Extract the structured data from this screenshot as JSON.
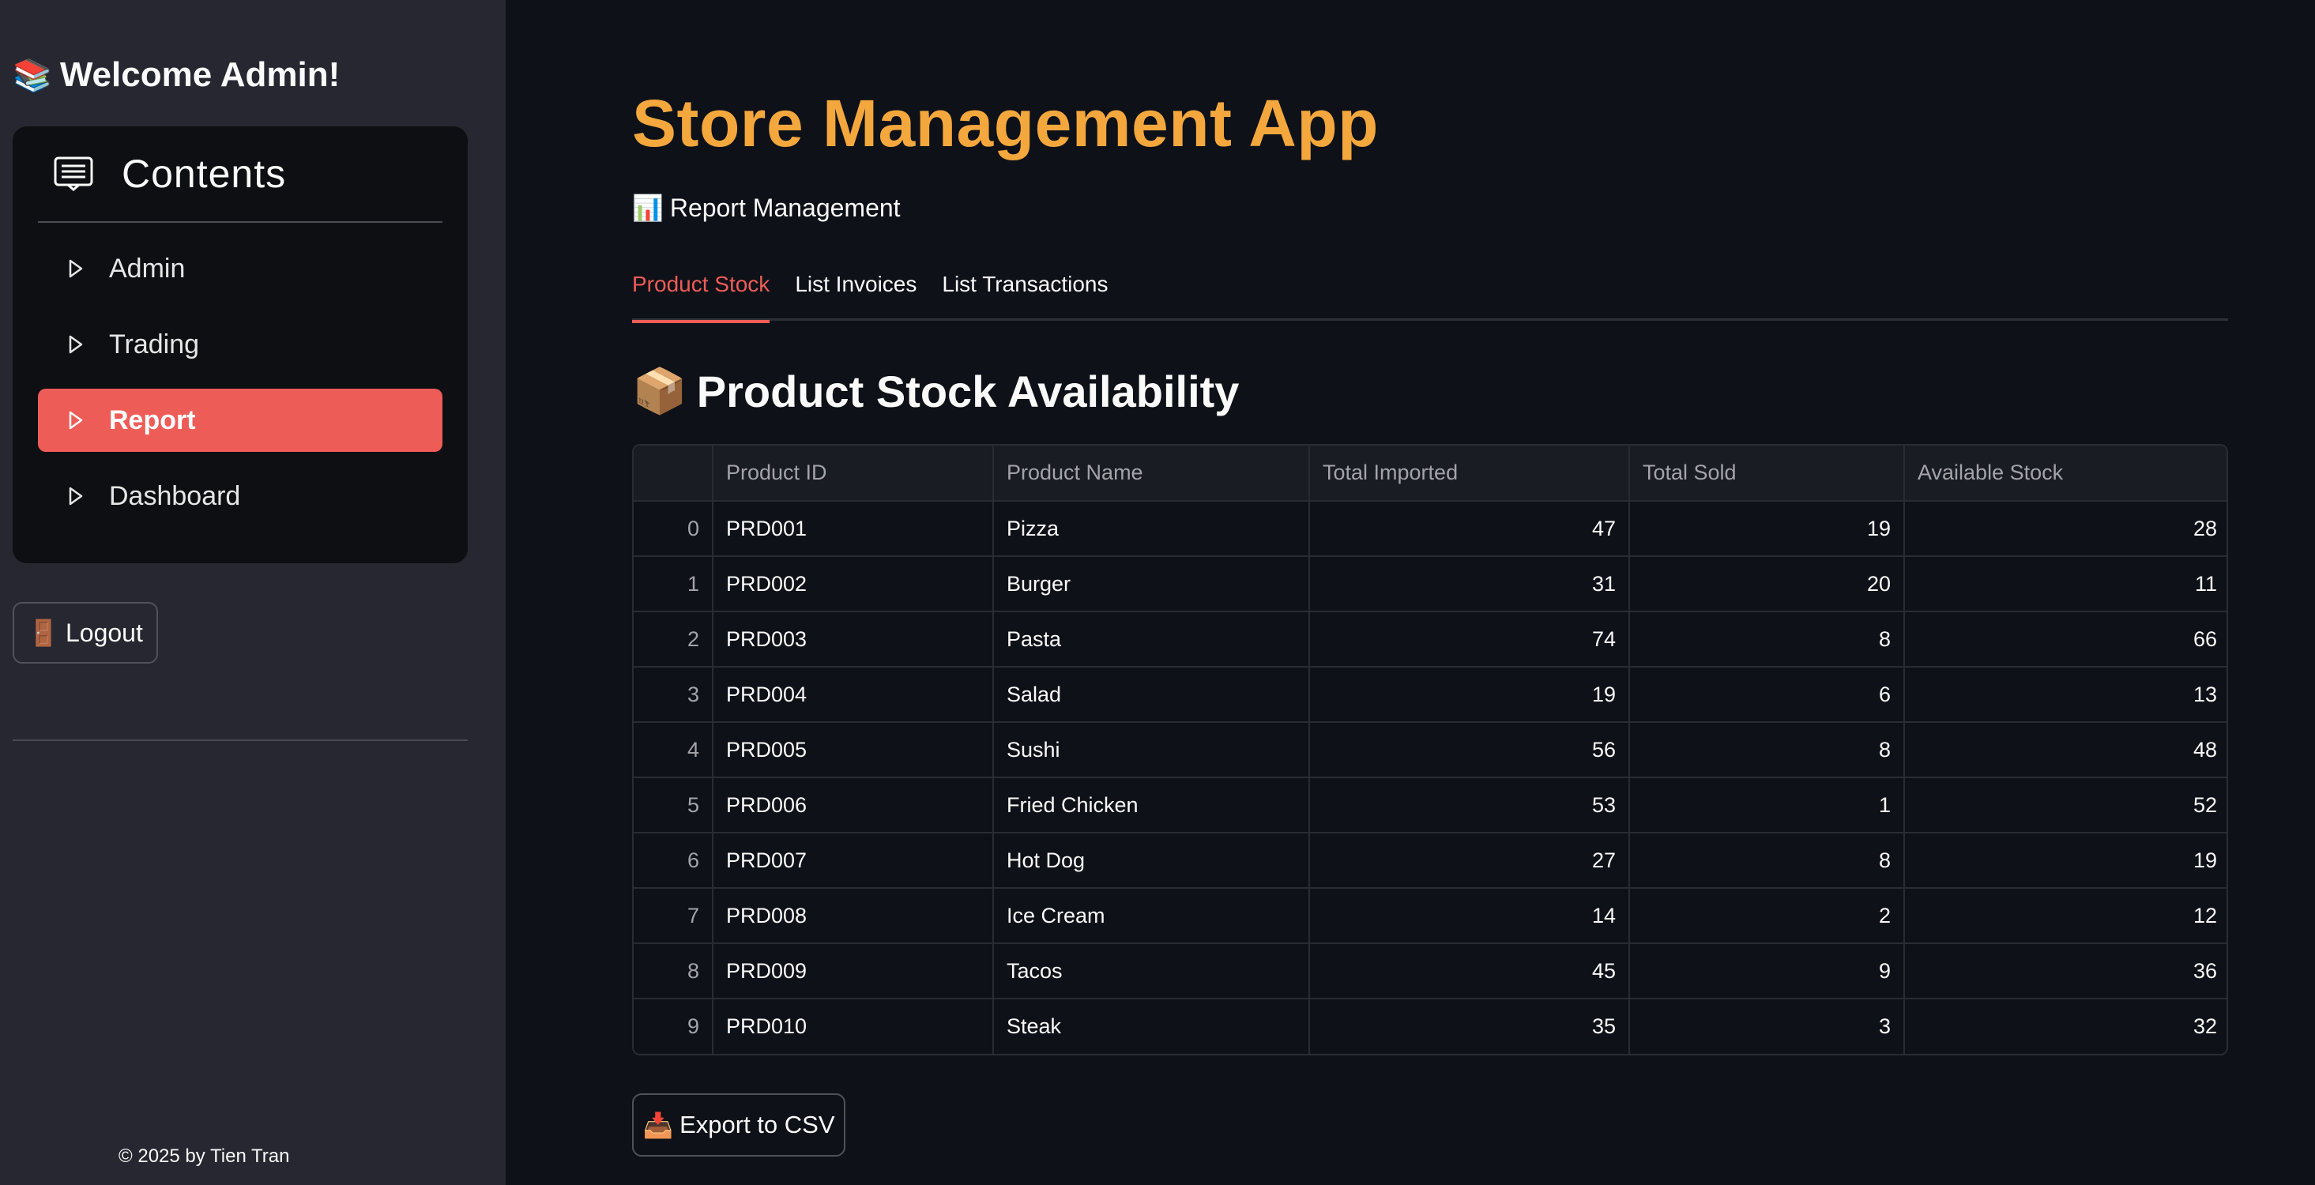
{
  "sidebar": {
    "welcome_emoji": "📚",
    "welcome_text": "Welcome Admin!",
    "menu_title": "Contents",
    "menu_icon": "document-list-icon",
    "items": [
      {
        "label": "Admin",
        "active": false
      },
      {
        "label": "Trading",
        "active": false
      },
      {
        "label": "Report",
        "active": true
      },
      {
        "label": "Dashboard",
        "active": false
      }
    ],
    "logout_emoji": "🚪",
    "logout_label": "Logout",
    "footer": "© 2025 by Tien Tran"
  },
  "main": {
    "title": "Store Management App",
    "subheading_emoji": "📊",
    "subheading": "Report Management",
    "tabs": [
      {
        "label": "Product Stock",
        "active": true
      },
      {
        "label": "List Invoices",
        "active": false
      },
      {
        "label": "List Transactions",
        "active": false
      }
    ],
    "section_emoji": "📦",
    "section_title": "Product Stock Availability",
    "table": {
      "columns": [
        "",
        "Product ID",
        "Product Name",
        "Total Imported",
        "Total Sold",
        "Available Stock"
      ],
      "rows": [
        [
          "0",
          "PRD001",
          "Pizza",
          "47",
          "19",
          "28"
        ],
        [
          "1",
          "PRD002",
          "Burger",
          "31",
          "20",
          "11"
        ],
        [
          "2",
          "PRD003",
          "Pasta",
          "74",
          "8",
          "66"
        ],
        [
          "3",
          "PRD004",
          "Salad",
          "19",
          "6",
          "13"
        ],
        [
          "4",
          "PRD005",
          "Sushi",
          "56",
          "8",
          "48"
        ],
        [
          "5",
          "PRD006",
          "Fried Chicken",
          "53",
          "1",
          "52"
        ],
        [
          "6",
          "PRD007",
          "Hot Dog",
          "27",
          "8",
          "19"
        ],
        [
          "7",
          "PRD008",
          "Ice Cream",
          "14",
          "2",
          "12"
        ],
        [
          "8",
          "PRD009",
          "Tacos",
          "45",
          "9",
          "36"
        ],
        [
          "9",
          "PRD010",
          "Steak",
          "35",
          "3",
          "32"
        ]
      ]
    },
    "export_emoji": "📥",
    "export_label": "Export to CSV"
  },
  "colors": {
    "accent": "#ee5c58",
    "title": "#f3a73d",
    "background": "#0e1117",
    "sidebar": "#262730"
  }
}
